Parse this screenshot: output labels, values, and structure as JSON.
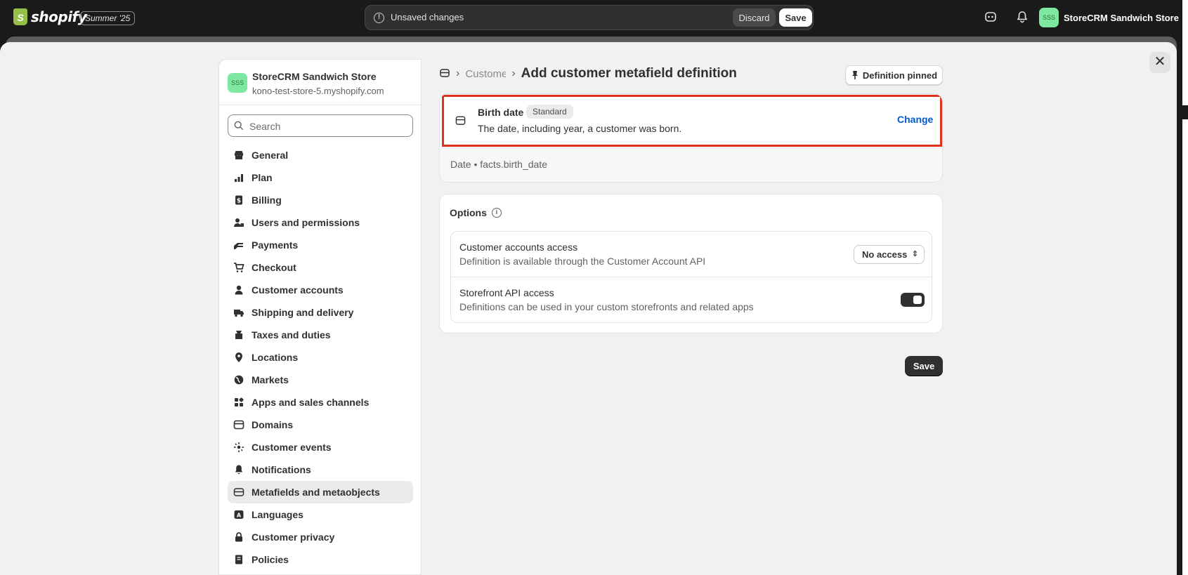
{
  "topbar": {
    "logo_text": "shopify",
    "edition": "Summer '25",
    "unsaved_message": "Unsaved changes",
    "discard_label": "Discard",
    "save_label": "Save",
    "store_avatar": "SSS",
    "store_name": "StoreCRM Sandwich Store"
  },
  "sidebar": {
    "store_avatar": "SSS",
    "store_name": "StoreCRM Sandwich Store",
    "store_domain": "kono-test-store-5.myshopify.com",
    "search_placeholder": "Search",
    "items": [
      {
        "label": "General",
        "icon": "store-icon"
      },
      {
        "label": "Plan",
        "icon": "plan-icon"
      },
      {
        "label": "Billing",
        "icon": "billing-icon"
      },
      {
        "label": "Users and permissions",
        "icon": "users-icon"
      },
      {
        "label": "Payments",
        "icon": "payments-icon"
      },
      {
        "label": "Checkout",
        "icon": "cart-icon"
      },
      {
        "label": "Customer accounts",
        "icon": "person-icon"
      },
      {
        "label": "Shipping and delivery",
        "icon": "truck-icon"
      },
      {
        "label": "Taxes and duties",
        "icon": "tax-icon"
      },
      {
        "label": "Locations",
        "icon": "location-icon"
      },
      {
        "label": "Markets",
        "icon": "globe-icon"
      },
      {
        "label": "Apps and sales channels",
        "icon": "apps-icon"
      },
      {
        "label": "Domains",
        "icon": "domain-icon"
      },
      {
        "label": "Customer events",
        "icon": "events-icon"
      },
      {
        "label": "Notifications",
        "icon": "bell-icon"
      },
      {
        "label": "Metafields and metaobjects",
        "icon": "metafields-icon",
        "active": true
      },
      {
        "label": "Languages",
        "icon": "languages-icon"
      },
      {
        "label": "Customer privacy",
        "icon": "lock-icon"
      },
      {
        "label": "Policies",
        "icon": "policy-icon"
      }
    ]
  },
  "main": {
    "breadcrumb_parent": "Customers",
    "page_title": "Add customer metafield definition",
    "pin_label": "Definition pinned",
    "definition": {
      "name": "Birth date",
      "badge": "Standard",
      "description": "The date, including year, a customer was born.",
      "change_label": "Change",
      "meta": "Date • facts.birth_date"
    },
    "options": {
      "title": "Options",
      "customer_access_title": "Customer accounts access",
      "customer_access_desc": "Definition is available through the Customer Account API",
      "customer_access_value": "No access",
      "storefront_title": "Storefront API access",
      "storefront_desc": "Definitions can be used in your custom storefronts and related apps",
      "storefront_enabled": true
    },
    "save_label": "Save"
  }
}
